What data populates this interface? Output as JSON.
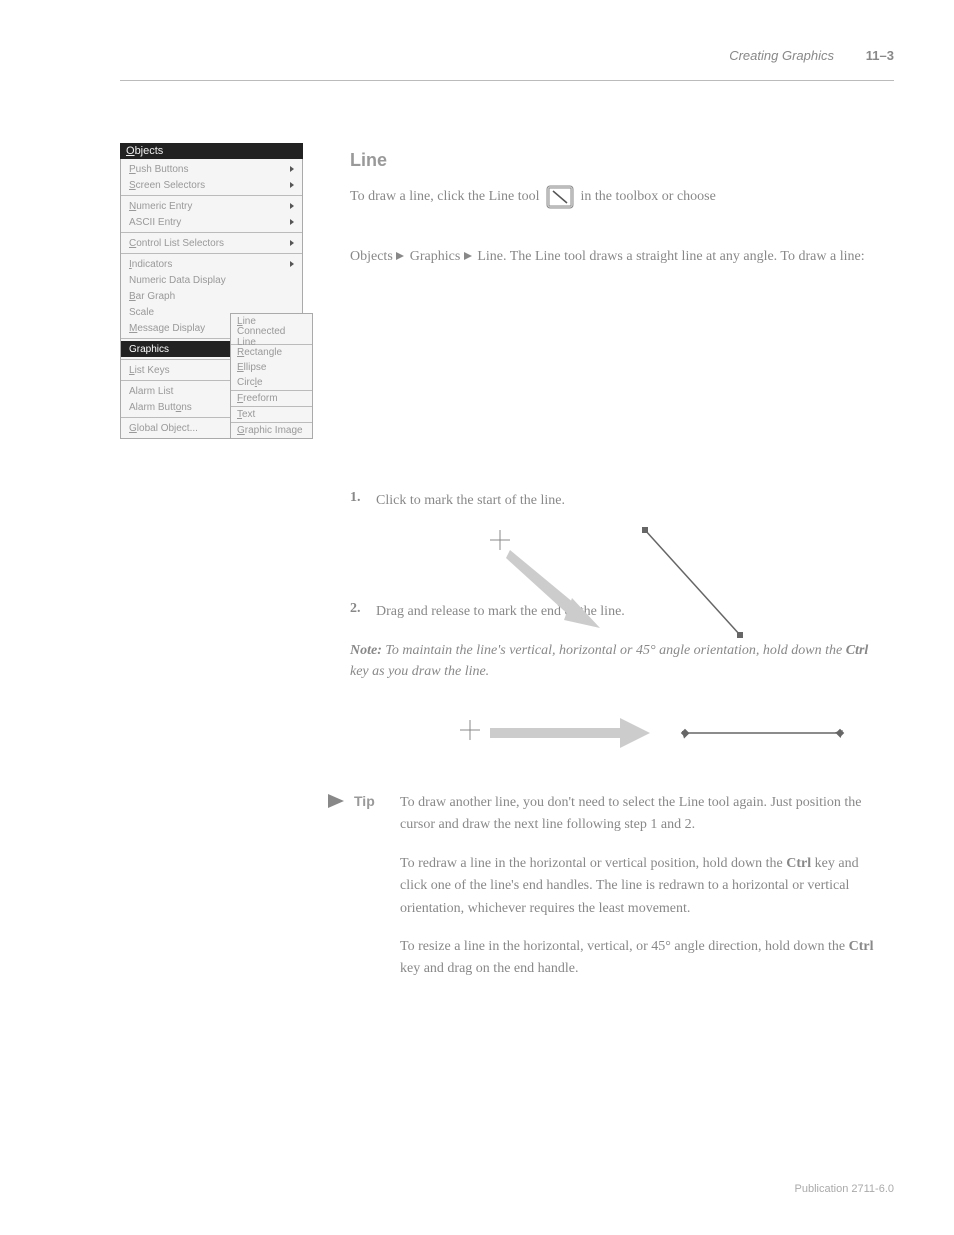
{
  "header": {
    "chapter": "Creating Graphics",
    "page": "11–3"
  },
  "section_heading": "Line",
  "body": {
    "p1a": "To draw a line, click the Line tool",
    "p1b": "in the toolbox or choose",
    "p2": "Objects    Graphics    Line. The Line tool draws a straight line at any angle. To draw a line:"
  },
  "menu": {
    "title": "Objects",
    "groups": [
      {
        "items": [
          {
            "label": "Push Buttons",
            "sub": true,
            "ul": "P"
          },
          {
            "label": "Screen Selectors",
            "sub": true,
            "ul": "S"
          }
        ]
      },
      {
        "items": [
          {
            "label": "Numeric Entry",
            "sub": true,
            "ul": "N"
          },
          {
            "label": "ASCII Entry",
            "sub": true
          }
        ]
      },
      {
        "items": [
          {
            "label": "Control List Selectors",
            "sub": true,
            "ul": "C"
          }
        ]
      },
      {
        "items": [
          {
            "label": "Indicators",
            "sub": true,
            "ul": "I"
          },
          {
            "label": "Numeric Data Display"
          },
          {
            "label": "Bar Graph",
            "ul": "B"
          },
          {
            "label": "Scale"
          },
          {
            "label": "Message Display",
            "ul": "M"
          }
        ]
      },
      {
        "items": [
          {
            "label": "Graphics",
            "sub": true,
            "highlight": true
          }
        ]
      },
      {
        "items": [
          {
            "label": "List Keys",
            "sub": true,
            "ul": "L"
          }
        ]
      },
      {
        "items": [
          {
            "label": "Alarm List"
          },
          {
            "label": "Alarm Buttons",
            "sub": true,
            "ul": "o"
          }
        ]
      },
      {
        "items": [
          {
            "label": "Global Object...",
            "ul": "G"
          }
        ]
      }
    ]
  },
  "submenu": {
    "groups": [
      {
        "items": [
          {
            "label": "Line",
            "ul": "L"
          },
          {
            "label": "Connected Line"
          }
        ]
      },
      {
        "items": [
          {
            "label": "Rectangle",
            "ul": "R"
          },
          {
            "label": "Ellipse",
            "ul": "E"
          },
          {
            "label": "Circle",
            "ul": "l"
          }
        ]
      },
      {
        "items": [
          {
            "label": "Freeform",
            "ul": "F"
          }
        ]
      },
      {
        "items": [
          {
            "label": "Text",
            "ul": "T"
          }
        ]
      },
      {
        "items": [
          {
            "label": "Graphic Image",
            "ul": "G"
          }
        ]
      }
    ]
  },
  "steps": {
    "s1": "Click to mark the start of the line.",
    "s2": "Drag and release to mark the end of the line."
  },
  "note": "Note: To maintain the line's vertical, horizontal or 45° angle orientation, hold down the Ctrl key as you draw the line.",
  "tip": {
    "heading": "Tip",
    "p1": "To draw another line, you don't need to select the Line tool again. Just position the cursor and draw the next line following step 1 and 2.",
    "p2": "To redraw a line in the horizontal or vertical position, hold down the Ctrl key and click one of the line's end handles. The line is redrawn to a horizontal or vertical orientation, whichever requires the least movement.",
    "p3": "To resize a line in the horizontal, vertical, or 45° angle direction, hold down the Ctrl key and drag on the end handle."
  },
  "footer": "Publication 2711-6.0"
}
